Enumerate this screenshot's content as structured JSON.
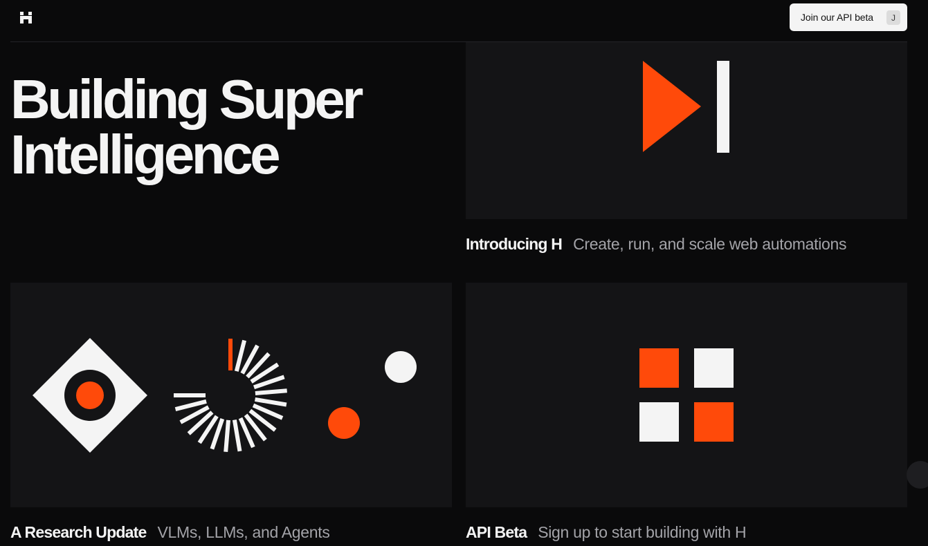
{
  "header": {
    "logo_icon": "h-logo-icon",
    "cta_label": "Join our API beta",
    "cta_shortcut": "J"
  },
  "hero": {
    "title_line1": "Building Super",
    "title_line2": "Intelligence"
  },
  "cards": {
    "intro": {
      "title": "Introducing H",
      "subtitle": "Create, run, and scale web automations",
      "icon": "play-skip-icon"
    },
    "research": {
      "title": "A Research Update",
      "subtitle": "VLMs, LLMs, and Agents",
      "icon": "research-shapes-icon"
    },
    "api": {
      "title": "API Beta",
      "subtitle": "Sign up to start building with H",
      "icon": "grid-squares-icon"
    }
  },
  "colors": {
    "background": "#0a0a0b",
    "panel": "#141416",
    "accent": "#ff4a0a",
    "light": "#f4f4f4",
    "muted_text": "#a3a3a8"
  }
}
